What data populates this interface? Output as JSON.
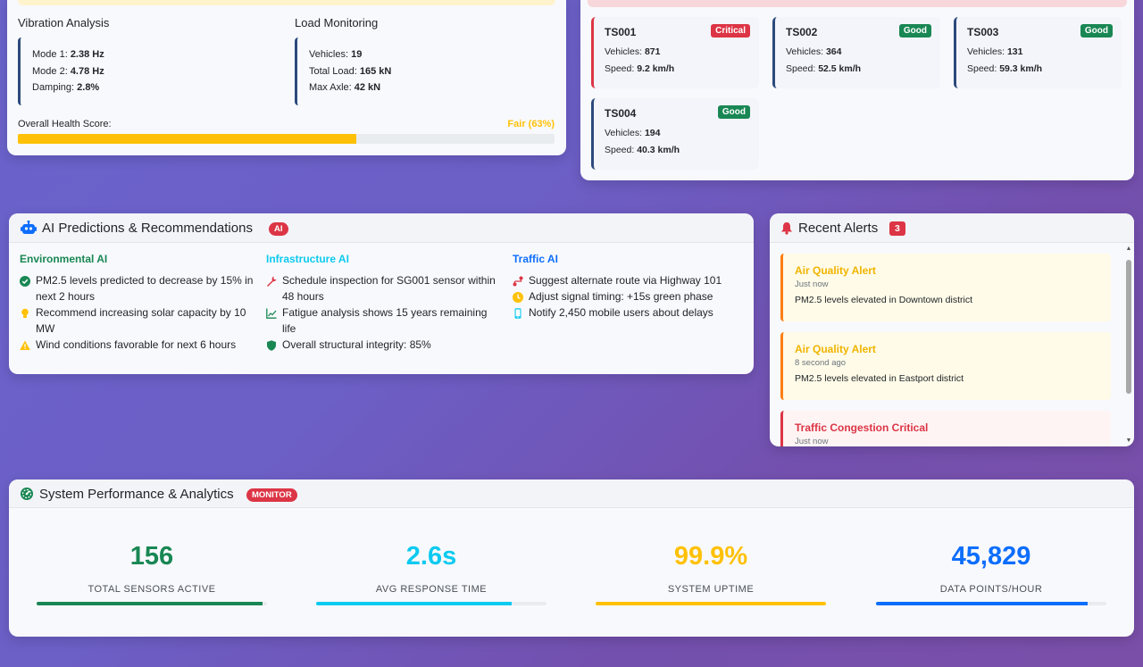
{
  "colors": {
    "good": "#198754",
    "critical": "#dc3545",
    "warning": "#ffc107",
    "info": "#0dcaf0",
    "primary": "#0d6efd"
  },
  "structural": {
    "vibration": {
      "title": "Vibration Analysis",
      "mode1_label": "Mode 1:",
      "mode1_value": "2.38 Hz",
      "mode2_label": "Mode 2:",
      "mode2_value": "4.78 Hz",
      "damping_label": "Damping:",
      "damping_value": "2.8%"
    },
    "load": {
      "title": "Load Monitoring",
      "vehicles_label": "Vehicles:",
      "vehicles_value": "19",
      "total_label": "Total Load:",
      "total_value": "165 kN",
      "axle_label": "Max Axle:",
      "axle_value": "42 kN"
    },
    "health": {
      "label": "Overall Health Score:",
      "value": "Fair (63%)",
      "percent": 63
    }
  },
  "traffic_sensors": [
    {
      "id": "TS001",
      "status": "Critical",
      "vehicles_label": "Vehicles:",
      "vehicles": "871",
      "speed_label": "Speed:",
      "speed": "9.2 km/h"
    },
    {
      "id": "TS002",
      "status": "Good",
      "vehicles_label": "Vehicles:",
      "vehicles": "364",
      "speed_label": "Speed:",
      "speed": "52.5 km/h"
    },
    {
      "id": "TS003",
      "status": "Good",
      "vehicles_label": "Vehicles:",
      "vehicles": "131",
      "speed_label": "Speed:",
      "speed": "59.3 km/h"
    },
    {
      "id": "TS004",
      "status": "Good",
      "vehicles_label": "Vehicles:",
      "vehicles": "194",
      "speed_label": "Speed:",
      "speed": "40.3 km/h"
    }
  ],
  "ai": {
    "title": "AI Predictions & Recommendations",
    "badge": "AI",
    "columns": [
      {
        "title": "Environmental AI",
        "items": [
          {
            "icon": "check-circle-icon",
            "text": "PM2.5 levels predicted to decrease by 15% in next 2 hours"
          },
          {
            "icon": "lightbulb-icon",
            "text": "Recommend increasing solar capacity by 10 MW"
          },
          {
            "icon": "warning-triangle-icon",
            "text": "Wind conditions favorable for next 6 hours"
          }
        ]
      },
      {
        "title": "Infrastructure AI",
        "items": [
          {
            "icon": "wrench-icon",
            "text": "Schedule inspection for SG001 sensor within 48 hours"
          },
          {
            "icon": "chart-line-icon",
            "text": "Fatigue analysis shows 15 years remaining life"
          },
          {
            "icon": "shield-icon",
            "text": "Overall structural integrity: 85%"
          }
        ]
      },
      {
        "title": "Traffic AI",
        "items": [
          {
            "icon": "route-icon",
            "text": "Suggest alternate route via Highway 101"
          },
          {
            "icon": "clock-icon",
            "text": "Adjust signal timing: +15s green phase"
          },
          {
            "icon": "mobile-icon",
            "text": "Notify 2,450 mobile users about delays"
          }
        ]
      }
    ]
  },
  "alerts": {
    "title": "Recent Alerts",
    "count": "3",
    "items": [
      {
        "title": "Air Quality Alert",
        "time": "Just now",
        "message": "PM2.5 levels elevated in Downtown district",
        "severity": "warning"
      },
      {
        "title": "Air Quality Alert",
        "time": "8 second ago",
        "message": "PM2.5 levels elevated in Eastport district",
        "severity": "warning"
      },
      {
        "title": "Traffic Congestion Critical",
        "time": "Just now",
        "message": "",
        "severity": "critical"
      }
    ]
  },
  "performance": {
    "title": "System Performance & Analytics",
    "badge": "MONITOR",
    "stats": [
      {
        "value": "156",
        "label": "Total Sensors Active",
        "color": "#198754",
        "fill": 98
      },
      {
        "value": "2.6s",
        "label": "Avg Response Time",
        "color": "#0dcaf0",
        "fill": 85
      },
      {
        "value": "99.9%",
        "label": "System Uptime",
        "color": "#ffc107",
        "fill": 100
      },
      {
        "value": "45,829",
        "label": "Data Points/Hour",
        "color": "#0d6efd",
        "fill": 92
      }
    ]
  }
}
